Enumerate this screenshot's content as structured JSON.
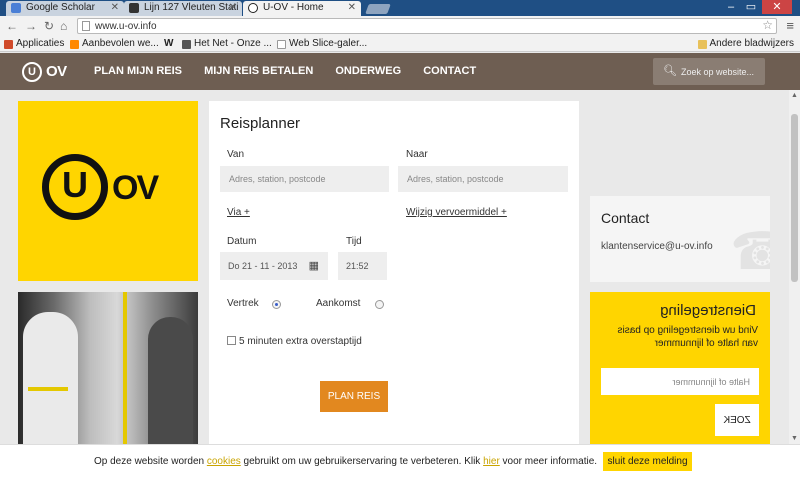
{
  "browser": {
    "tabs": [
      {
        "label": "Google Scholar",
        "color": "#4a7fd6"
      },
      {
        "label": "Lijn 127 Vleuten Stati",
        "color": "#333333"
      },
      {
        "label": "U-OV - Home",
        "color": "#222222"
      }
    ],
    "url": "www.u-ov.info",
    "bookmarks": [
      {
        "label": "Applicaties",
        "color": "#d04a2a"
      },
      {
        "label": "Aanbevolen we...",
        "color": "#ff8800"
      },
      {
        "label": "W",
        "color": "#ffffff"
      },
      {
        "label": "Het Net - Onze ...",
        "color": "#555555"
      },
      {
        "label": "Web Slice-galer...",
        "color": "#dddddd"
      }
    ],
    "other_bookmarks": "Andere bladwijzers"
  },
  "site": {
    "logo_mark": "U",
    "logo_text": "OV",
    "nav": [
      "PLAN MIJN REIS",
      "MIJN REIS BETALEN",
      "ONDERWEG",
      "CONTACT"
    ],
    "search_placeholder": "Zoek op website...",
    "brand_yellow": "#ffd500",
    "header_brown": "#6e5e52",
    "accent_orange": "#e2881f"
  },
  "planner": {
    "title": "Reisplanner",
    "from_label": "Van",
    "from_placeholder": "Adres, station, postcode",
    "to_label": "Naar",
    "to_placeholder": "Adres, station, postcode",
    "via_link": "Via +",
    "change_mode_link": "Wijzig vervoermiddel +",
    "date_label": "Datum",
    "date_value": "Do 21 - 11 - 2013",
    "time_label": "Tijd",
    "time_value": "21:52",
    "departure_label": "Vertrek",
    "arrival_label": "Aankomst",
    "extra_transfer_label": "5 minuten extra overstaptijd",
    "plan_button": "PLAN REIS"
  },
  "contact": {
    "title": "Contact",
    "email": "klantenservice@u-ov.info"
  },
  "dienstregeling": {
    "title": "Dienstregeling",
    "description": "Vind uw dienstregeling op basis van halte of lijnnummer",
    "input_placeholder": "Halte of lijnnummer",
    "search_button": "ZOEK"
  },
  "cookie": {
    "part1": "Op deze website worden ",
    "link1": "cookies",
    "part2": " gebruikt om uw gebruikerservaring te verbeteren. Klik ",
    "link2": "hier",
    "part3": " voor meer informatie.",
    "button": "sluit deze melding"
  }
}
